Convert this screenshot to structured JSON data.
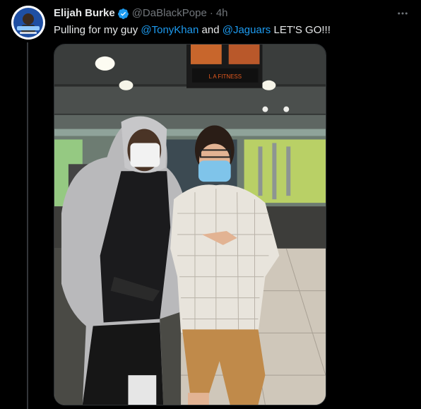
{
  "tweet": {
    "author_name": "Elijah Burke",
    "author_handle": "@DaBlackPope",
    "separator": "·",
    "timestamp": "4h",
    "text_prefix": "Pulling for my guy ",
    "mention_1": "@TonyKhan",
    "text_middle": " and ",
    "mention_2": "@Jaguars",
    "text_suffix": " LET'S GO!!!",
    "media_sign": "L A FITNESS"
  },
  "colors": {
    "background": "#000000",
    "text": "#e7e9ea",
    "secondary": "#71767b",
    "accent": "#1d9bf0"
  },
  "icons": {
    "verified": "verified-badge-icon",
    "more": "more-options-icon"
  }
}
